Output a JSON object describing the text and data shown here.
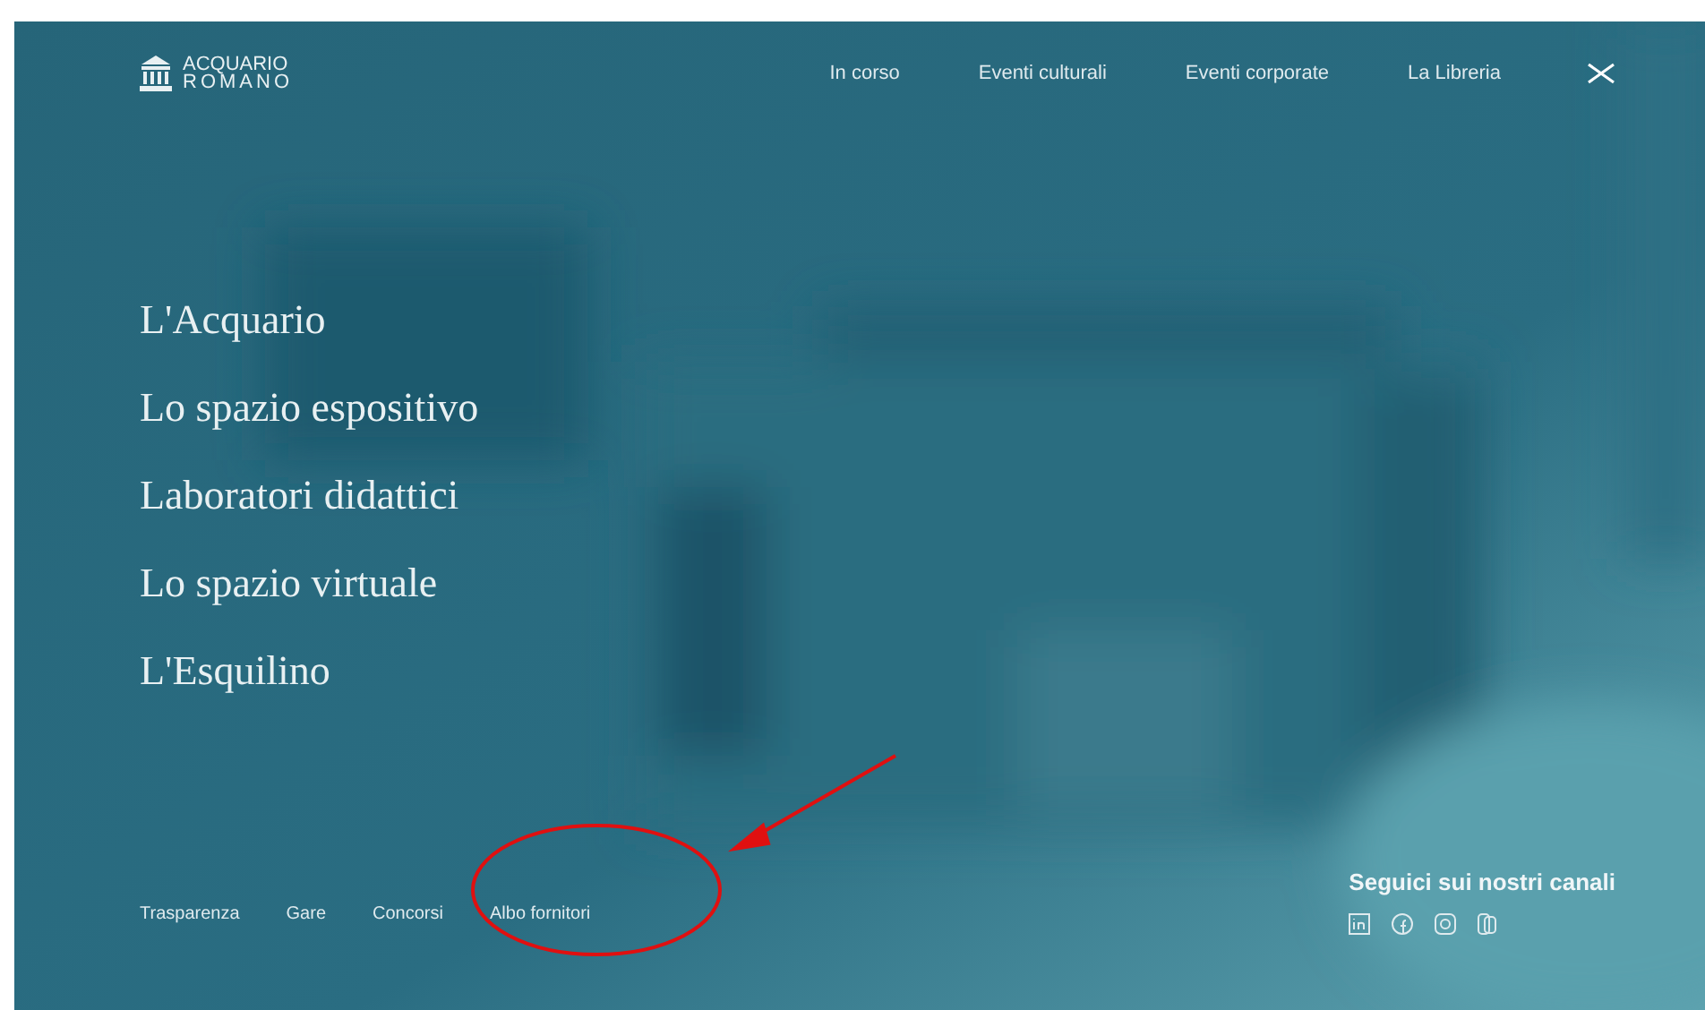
{
  "logo": {
    "line1": "ACQUARIO",
    "line2": "ROMANO"
  },
  "nav": [
    "In corso",
    "Eventi culturali",
    "Eventi corporate",
    "La Libreria"
  ],
  "menu": [
    "L'Acquario",
    "Lo spazio espositivo",
    "Laboratori didattici",
    "Lo spazio virtuale",
    "L'Esquilino"
  ],
  "footer_links": [
    "Trasparenza",
    "Gare",
    "Concorsi",
    "Albo fornitori"
  ],
  "social": {
    "title": "Seguici sui nostri canali"
  }
}
